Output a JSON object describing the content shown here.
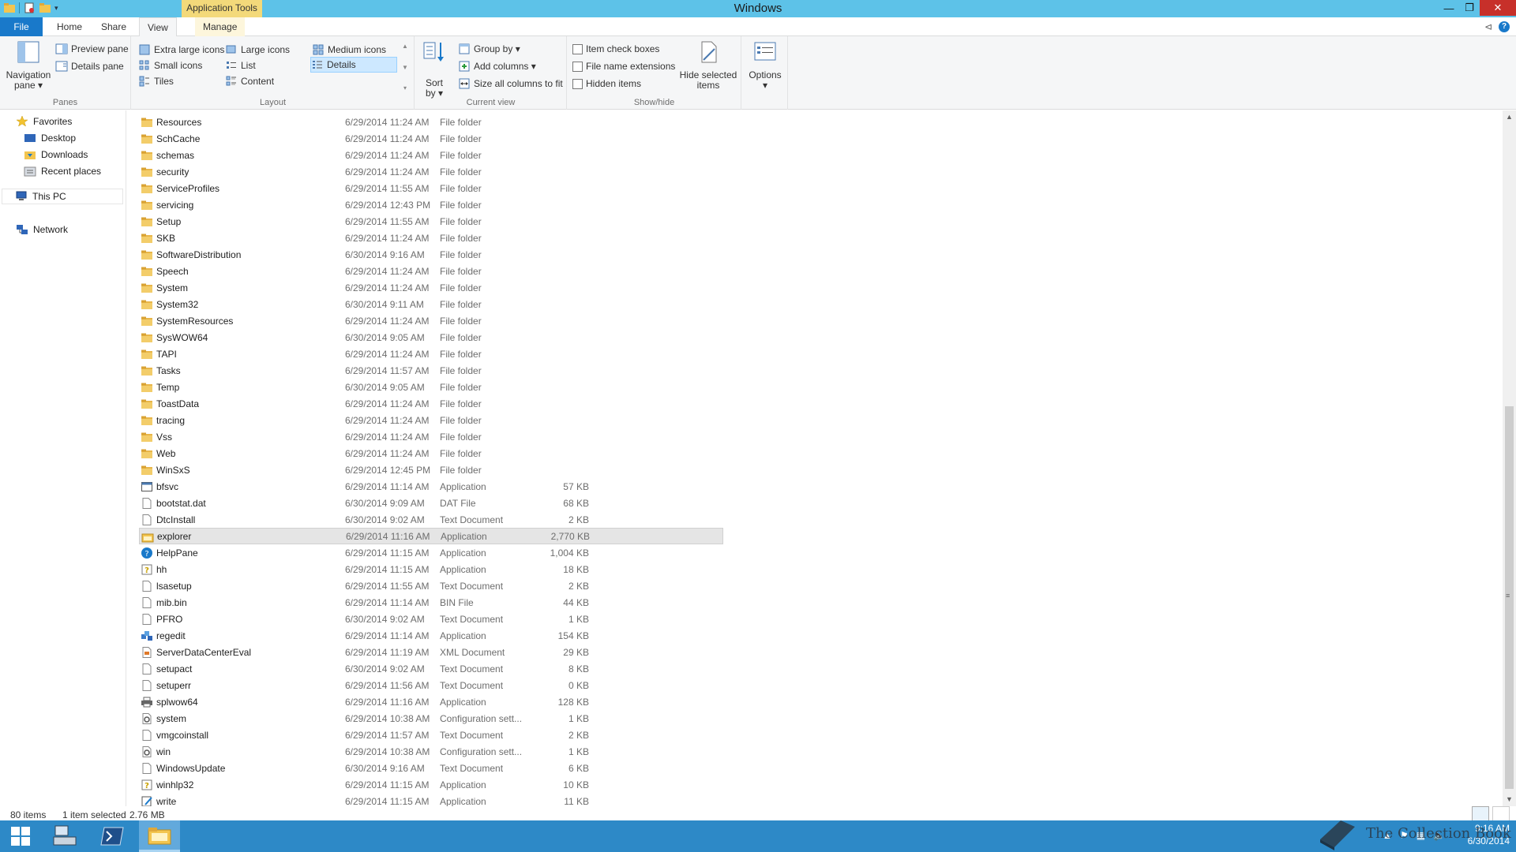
{
  "window": {
    "title": "Windows",
    "context_tab": "Application Tools",
    "controls": {
      "minimize": "—",
      "maximize": "❐",
      "close": "✕"
    }
  },
  "ribbon_tabs": [
    "File",
    "Home",
    "Share",
    "View",
    "Manage"
  ],
  "ribbon_right": {
    "minimize": "⊲",
    "help": "?"
  },
  "ribbon": {
    "panes": {
      "label": "Panes",
      "navigation_pane": "Navigation",
      "navigation_pane_2": "pane ▾",
      "preview_pane": "Preview pane",
      "details_pane": "Details pane"
    },
    "layout": {
      "label": "Layout",
      "extra_large_icons": "Extra large icons",
      "large_icons": "Large icons",
      "medium_icons": "Medium icons",
      "small_icons": "Small icons",
      "list": "List",
      "details": "Details",
      "tiles": "Tiles",
      "content": "Content"
    },
    "current_view": {
      "label": "Current view",
      "sort_by": "Sort",
      "sort_by_2": "by ▾",
      "group_by": "Group by ▾",
      "add_columns": "Add columns ▾",
      "size_all_columns": "Size all columns to fit"
    },
    "show_hide": {
      "label": "Show/hide",
      "item_check_boxes": "Item check boxes",
      "file_name_extensions": "File name extensions",
      "hidden_items": "Hidden items",
      "hide_selected": "Hide selected",
      "hide_selected_2": "items"
    },
    "options": {
      "label": "Options",
      "arrow": "▾"
    }
  },
  "nav": {
    "favorites": "Favorites",
    "desktop": "Desktop",
    "downloads": "Downloads",
    "recent_places": "Recent places",
    "this_pc": "This PC",
    "network": "Network"
  },
  "files": [
    {
      "name": "Resources",
      "date": "6/29/2014 11:24 AM",
      "type": "File folder",
      "size": "",
      "icon": "folder"
    },
    {
      "name": "SchCache",
      "date": "6/29/2014 11:24 AM",
      "type": "File folder",
      "size": "",
      "icon": "folder"
    },
    {
      "name": "schemas",
      "date": "6/29/2014 11:24 AM",
      "type": "File folder",
      "size": "",
      "icon": "folder"
    },
    {
      "name": "security",
      "date": "6/29/2014 11:24 AM",
      "type": "File folder",
      "size": "",
      "icon": "folder"
    },
    {
      "name": "ServiceProfiles",
      "date": "6/29/2014 11:55 AM",
      "type": "File folder",
      "size": "",
      "icon": "folder"
    },
    {
      "name": "servicing",
      "date": "6/29/2014 12:43 PM",
      "type": "File folder",
      "size": "",
      "icon": "folder"
    },
    {
      "name": "Setup",
      "date": "6/29/2014 11:55 AM",
      "type": "File folder",
      "size": "",
      "icon": "folder"
    },
    {
      "name": "SKB",
      "date": "6/29/2014 11:24 AM",
      "type": "File folder",
      "size": "",
      "icon": "folder"
    },
    {
      "name": "SoftwareDistribution",
      "date": "6/30/2014 9:16 AM",
      "type": "File folder",
      "size": "",
      "icon": "folder"
    },
    {
      "name": "Speech",
      "date": "6/29/2014 11:24 AM",
      "type": "File folder",
      "size": "",
      "icon": "folder"
    },
    {
      "name": "System",
      "date": "6/29/2014 11:24 AM",
      "type": "File folder",
      "size": "",
      "icon": "folder"
    },
    {
      "name": "System32",
      "date": "6/30/2014 9:11 AM",
      "type": "File folder",
      "size": "",
      "icon": "folder"
    },
    {
      "name": "SystemResources",
      "date": "6/29/2014 11:24 AM",
      "type": "File folder",
      "size": "",
      "icon": "folder"
    },
    {
      "name": "SysWOW64",
      "date": "6/30/2014 9:05 AM",
      "type": "File folder",
      "size": "",
      "icon": "folder"
    },
    {
      "name": "TAPI",
      "date": "6/29/2014 11:24 AM",
      "type": "File folder",
      "size": "",
      "icon": "folder"
    },
    {
      "name": "Tasks",
      "date": "6/29/2014 11:57 AM",
      "type": "File folder",
      "size": "",
      "icon": "folder"
    },
    {
      "name": "Temp",
      "date": "6/30/2014 9:05 AM",
      "type": "File folder",
      "size": "",
      "icon": "folder"
    },
    {
      "name": "ToastData",
      "date": "6/29/2014 11:24 AM",
      "type": "File folder",
      "size": "",
      "icon": "folder"
    },
    {
      "name": "tracing",
      "date": "6/29/2014 11:24 AM",
      "type": "File folder",
      "size": "",
      "icon": "folder"
    },
    {
      "name": "Vss",
      "date": "6/29/2014 11:24 AM",
      "type": "File folder",
      "size": "",
      "icon": "folder"
    },
    {
      "name": "Web",
      "date": "6/29/2014 11:24 AM",
      "type": "File folder",
      "size": "",
      "icon": "folder"
    },
    {
      "name": "WinSxS",
      "date": "6/29/2014 12:45 PM",
      "type": "File folder",
      "size": "",
      "icon": "folder"
    },
    {
      "name": "bfsvc",
      "date": "6/29/2014 11:14 AM",
      "type": "Application",
      "size": "57 KB",
      "icon": "app"
    },
    {
      "name": "bootstat.dat",
      "date": "6/30/2014 9:09 AM",
      "type": "DAT File",
      "size": "68 KB",
      "icon": "doc"
    },
    {
      "name": "DtcInstall",
      "date": "6/30/2014 9:02 AM",
      "type": "Text Document",
      "size": "2 KB",
      "icon": "doc"
    },
    {
      "name": "explorer",
      "date": "6/29/2014 11:16 AM",
      "type": "Application",
      "size": "2,770 KB",
      "icon": "explorer"
    },
    {
      "name": "HelpPane",
      "date": "6/29/2014 11:15 AM",
      "type": "Application",
      "size": "1,004 KB",
      "icon": "help"
    },
    {
      "name": "hh",
      "date": "6/29/2014 11:15 AM",
      "type": "Application",
      "size": "18 KB",
      "icon": "hh"
    },
    {
      "name": "lsasetup",
      "date": "6/29/2014 11:55 AM",
      "type": "Text Document",
      "size": "2 KB",
      "icon": "doc"
    },
    {
      "name": "mib.bin",
      "date": "6/29/2014 11:14 AM",
      "type": "BIN File",
      "size": "44 KB",
      "icon": "doc"
    },
    {
      "name": "PFRO",
      "date": "6/30/2014 9:02 AM",
      "type": "Text Document",
      "size": "1 KB",
      "icon": "doc"
    },
    {
      "name": "regedit",
      "date": "6/29/2014 11:14 AM",
      "type": "Application",
      "size": "154 KB",
      "icon": "regedit"
    },
    {
      "name": "ServerDataCenterEval",
      "date": "6/29/2014 11:19 AM",
      "type": "XML Document",
      "size": "29 KB",
      "icon": "xml"
    },
    {
      "name": "setupact",
      "date": "6/30/2014 9:02 AM",
      "type": "Text Document",
      "size": "8 KB",
      "icon": "doc"
    },
    {
      "name": "setuperr",
      "date": "6/29/2014 11:56 AM",
      "type": "Text Document",
      "size": "0 KB",
      "icon": "doc"
    },
    {
      "name": "splwow64",
      "date": "6/29/2014 11:16 AM",
      "type": "Application",
      "size": "128 KB",
      "icon": "printer"
    },
    {
      "name": "system",
      "date": "6/29/2014 10:38 AM",
      "type": "Configuration sett...",
      "size": "1 KB",
      "icon": "config"
    },
    {
      "name": "vmgcoinstall",
      "date": "6/29/2014 11:57 AM",
      "type": "Text Document",
      "size": "2 KB",
      "icon": "doc"
    },
    {
      "name": "win",
      "date": "6/29/2014 10:38 AM",
      "type": "Configuration sett...",
      "size": "1 KB",
      "icon": "config"
    },
    {
      "name": "WindowsUpdate",
      "date": "6/30/2014 9:16 AM",
      "type": "Text Document",
      "size": "6 KB",
      "icon": "doc"
    },
    {
      "name": "winhlp32",
      "date": "6/29/2014 11:15 AM",
      "type": "Application",
      "size": "10 KB",
      "icon": "hh"
    },
    {
      "name": "write",
      "date": "6/29/2014 11:15 AM",
      "type": "Application",
      "size": "11 KB",
      "icon": "write"
    }
  ],
  "selected_file": "explorer",
  "status": {
    "item_count": "80 items",
    "selection": "1 item selected",
    "selection_size": "2.76 MB"
  },
  "taskbar": {
    "clock_time": "9:16 AM",
    "clock_date": "6/30/2014"
  },
  "watermark": "The Collection Book",
  "colors": {
    "titlebar": "#5dc2e8",
    "file_tab": "#1979ca",
    "taskbar": "#2d89c7",
    "folder": "#e8b64a",
    "selection": "#e5e5e5"
  }
}
